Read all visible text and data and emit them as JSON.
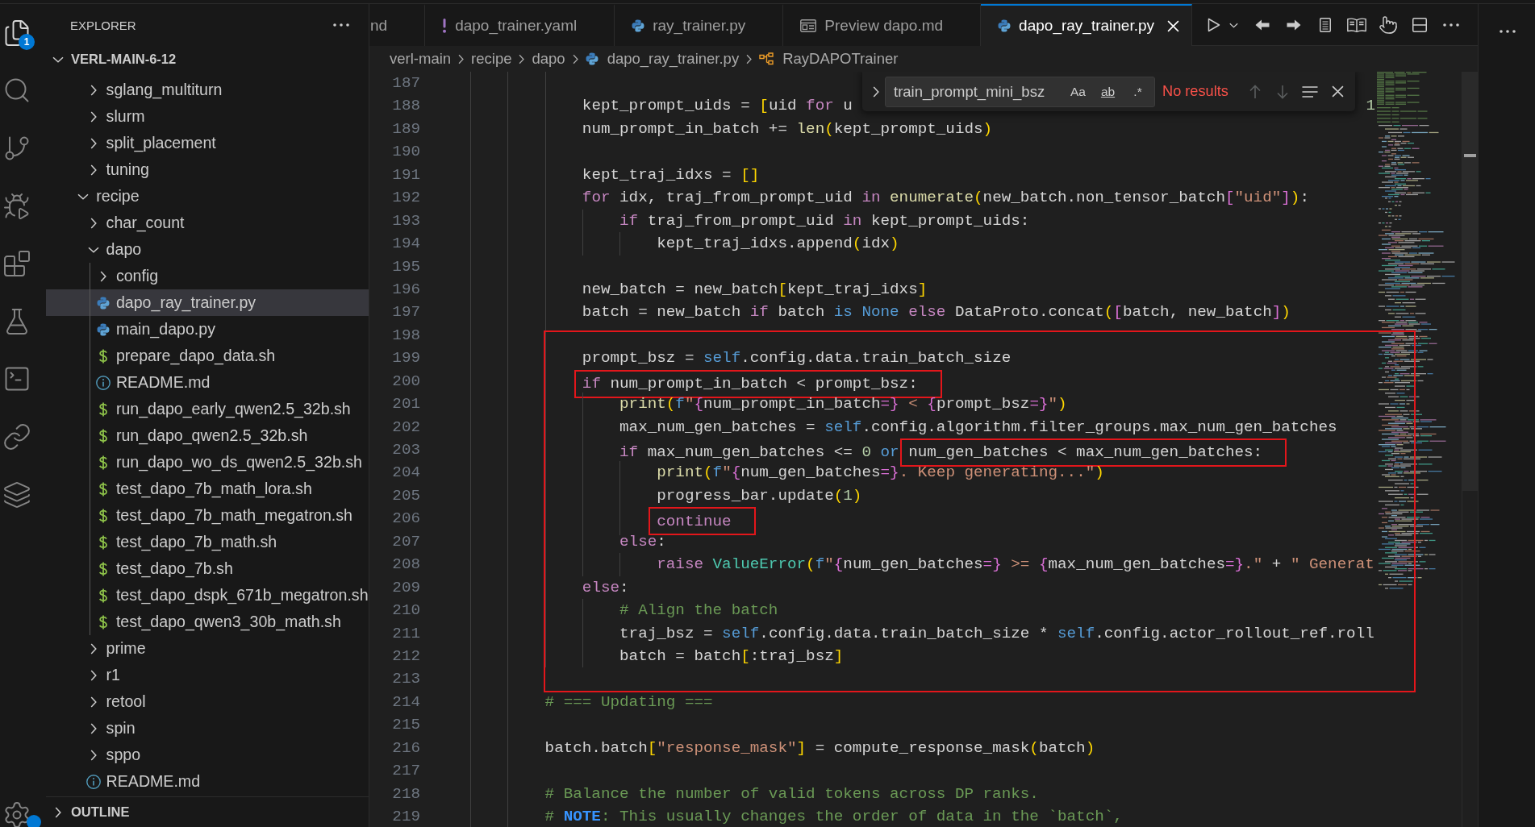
{
  "activity_bar": {
    "items": [
      {
        "kind": "explorer",
        "selected": true,
        "badge": "1"
      },
      {
        "kind": "search",
        "selected": false
      },
      {
        "kind": "source_control",
        "selected": false
      },
      {
        "kind": "run_debug",
        "selected": false
      },
      {
        "kind": "extensions",
        "selected": false
      },
      {
        "kind": "testing",
        "selected": false
      },
      {
        "kind": "terminal",
        "selected": false
      },
      {
        "kind": "link",
        "selected": false
      },
      {
        "kind": "layers",
        "selected": false
      }
    ],
    "manage": {
      "notification": true
    }
  },
  "explorer": {
    "title": "EXPLORER",
    "root": {
      "label": "VERL-MAIN-6-12",
      "expanded": true
    },
    "tree": [
      {
        "children": [
          {
            "label": "sglang_multiturn",
            "kind": "folder",
            "expanded": false,
            "selected": false
          },
          {
            "label": "slurm",
            "kind": "folder",
            "expanded": false,
            "selected": false
          },
          {
            "label": "split_placement",
            "kind": "folder",
            "expanded": false,
            "selected": false
          },
          {
            "label": "tuning",
            "kind": "folder",
            "expanded": false,
            "selected": false
          }
        ]
      },
      {
        "label": "recipe",
        "kind": "folder",
        "expanded": true,
        "selected": false,
        "children": [
          {
            "label": "char_count",
            "kind": "folder",
            "expanded": false,
            "selected": false
          },
          {
            "label": "dapo",
            "kind": "folder",
            "expanded": true,
            "selected": false,
            "children": [
              {
                "label": "config",
                "kind": "folder",
                "expanded": false,
                "selected": false
              },
              {
                "label": "dapo_ray_trainer.py",
                "kind": "python",
                "selected": true
              },
              {
                "label": "main_dapo.py",
                "kind": "python",
                "selected": false
              },
              {
                "label": "prepare_dapo_data.sh",
                "kind": "shell",
                "selected": false
              },
              {
                "label": "README.md",
                "kind": "markdown",
                "selected": false
              },
              {
                "label": "run_dapo_early_qwen2.5_32b.sh",
                "kind": "shell",
                "selected": false
              },
              {
                "label": "run_dapo_qwen2.5_32b.sh",
                "kind": "shell",
                "selected": false
              },
              {
                "label": "run_dapo_wo_ds_qwen2.5_32b.sh",
                "kind": "shell",
                "selected": false
              },
              {
                "label": "test_dapo_7b_math_lora.sh",
                "kind": "shell",
                "selected": false
              },
              {
                "label": "test_dapo_7b_math_megatron.sh",
                "kind": "shell",
                "selected": false
              },
              {
                "label": "test_dapo_7b_math.sh",
                "kind": "shell",
                "selected": false
              },
              {
                "label": "test_dapo_7b.sh",
                "kind": "shell",
                "selected": false
              },
              {
                "label": "test_dapo_dspk_671b_megatron.sh",
                "kind": "shell",
                "selected": false
              },
              {
                "label": "test_dapo_qwen3_30b_math.sh",
                "kind": "shell",
                "selected": false
              }
            ]
          },
          {
            "label": "prime",
            "kind": "folder",
            "expanded": false,
            "selected": false
          },
          {
            "label": "r1",
            "kind": "folder",
            "expanded": false,
            "selected": false
          },
          {
            "label": "retool",
            "kind": "folder",
            "expanded": false,
            "selected": false
          },
          {
            "label": "spin",
            "kind": "folder",
            "expanded": false,
            "selected": false
          },
          {
            "label": "sppo",
            "kind": "folder",
            "expanded": false,
            "selected": false
          },
          {
            "label": "README.md",
            "kind": "markdown",
            "selected": false
          }
        ]
      }
    ],
    "outline": {
      "label": "OUTLINE",
      "expanded": false
    }
  },
  "tabs": [
    {
      "label": "nd",
      "kind": "partial",
      "selected": false
    },
    {
      "label": "dapo_trainer.yaml",
      "kind": "yaml",
      "selected": false
    },
    {
      "label": "ray_trainer.py",
      "kind": "python",
      "selected": false
    },
    {
      "label": "Preview dapo.md",
      "kind": "preview",
      "selected": false
    },
    {
      "label": "dapo_ray_trainer.py",
      "kind": "python",
      "selected": true
    }
  ],
  "breadcrumbs": [
    {
      "label": "verl-main",
      "kind": "folder"
    },
    {
      "label": "recipe",
      "kind": "folder"
    },
    {
      "label": "dapo",
      "kind": "folder"
    },
    {
      "label": "dapo_ray_trainer.py",
      "kind": "python"
    },
    {
      "label": "RayDAPOTrainer",
      "kind": "class"
    }
  ],
  "find_widget": {
    "query": "train_prompt_mini_bsz",
    "options": [
      {
        "label": "Aa",
        "kind": "match_case",
        "on": false
      },
      {
        "label": "ab",
        "kind": "whole_word",
        "on": false
      },
      {
        "label": ".*",
        "kind": "regex",
        "on": false
      }
    ],
    "status": "No results",
    "buttons": [
      {
        "kind": "previous",
        "disabled": true
      },
      {
        "kind": "next",
        "disabled": true
      },
      {
        "kind": "in_selection",
        "disabled": false
      },
      {
        "kind": "close",
        "disabled": false
      }
    ]
  },
  "code": {
    "segments": [
      {
        "marked": false,
        "lines": [
          {
            "number": "187"
          },
          {
            "number": "188",
            "tokens": [
              {
                "text": "                kept_prompt_uids = ",
                "kind": "plain"
              },
              {
                "text": "[",
                "kind": "bracket_1"
              },
              {
                "text": "uid ",
                "kind": "plain"
              },
              {
                "text": "for",
                "kind": "control"
              },
              {
                "text": " u",
                "kind": "plain"
              }
            ],
            "tail": [
              {
                "text": "1",
                "kind": "number"
              }
            ]
          },
          {
            "number": "189",
            "tokens": [
              {
                "text": "                num_prompt_in_batch += ",
                "kind": "plain"
              },
              {
                "text": "len",
                "kind": "call"
              },
              {
                "text": "(",
                "kind": "bracket_1"
              },
              {
                "text": "kept_prompt_uids",
                "kind": "plain"
              },
              {
                "text": ")",
                "kind": "bracket_1"
              }
            ]
          },
          {
            "number": "190"
          },
          {
            "number": "191",
            "tokens": [
              {
                "text": "                kept_traj_idxs = ",
                "kind": "plain"
              },
              {
                "text": "[]",
                "kind": "bracket_1"
              }
            ]
          },
          {
            "number": "192",
            "tokens": [
              {
                "text": "                for",
                "kind": "control"
              },
              {
                "text": " idx, traj_from_prompt_uid ",
                "kind": "plain"
              },
              {
                "text": "in",
                "kind": "control"
              },
              {
                "text": " enumerate",
                "kind": "call"
              },
              {
                "text": "(",
                "kind": "bracket_1"
              },
              {
                "text": "new_batch.non_tensor_batch",
                "kind": "plain"
              },
              {
                "text": "[",
                "kind": "bracket_2"
              },
              {
                "text": "\"uid\"",
                "kind": "string"
              },
              {
                "text": "]",
                "kind": "bracket_2"
              },
              {
                "text": ")",
                "kind": "bracket_1"
              },
              {
                "text": ":",
                "kind": "plain"
              }
            ]
          },
          {
            "number": "193",
            "tokens": [
              {
                "text": "                    if",
                "kind": "control"
              },
              {
                "text": " traj_from_prompt_uid ",
                "kind": "plain"
              },
              {
                "text": "in",
                "kind": "control"
              },
              {
                "text": " kept_prompt_uids:",
                "kind": "plain"
              }
            ]
          },
          {
            "number": "194",
            "tokens": [
              {
                "text": "                        kept_traj_idxs.append",
                "kind": "plain"
              },
              {
                "text": "(",
                "kind": "bracket_1"
              },
              {
                "text": "idx",
                "kind": "plain"
              },
              {
                "text": ")",
                "kind": "bracket_1"
              }
            ]
          },
          {
            "number": "195"
          },
          {
            "number": "196",
            "tokens": [
              {
                "text": "                new_batch = new_batch",
                "kind": "plain"
              },
              {
                "text": "[",
                "kind": "bracket_1"
              },
              {
                "text": "kept_traj_idxs",
                "kind": "plain"
              },
              {
                "text": "]",
                "kind": "bracket_1"
              }
            ]
          },
          {
            "number": "197",
            "tokens": [
              {
                "text": "                batch = new_batch ",
                "kind": "plain"
              },
              {
                "text": "if",
                "kind": "control"
              },
              {
                "text": " batch ",
                "kind": "plain"
              },
              {
                "text": "is None",
                "kind": "builtin"
              },
              {
                "text": " else",
                "kind": "control"
              },
              {
                "text": " DataProto.concat",
                "kind": "plain"
              },
              {
                "text": "(",
                "kind": "bracket_1"
              },
              {
                "text": "[",
                "kind": "bracket_2"
              },
              {
                "text": "batch, new_batch",
                "kind": "plain"
              },
              {
                "text": "]",
                "kind": "bracket_2"
              },
              {
                "text": ")",
                "kind": "bracket_1"
              }
            ]
          }
        ]
      },
      {
        "marked": true,
        "lines": [
          {
            "number": "198"
          },
          {
            "number": "199",
            "tokens": [
              {
                "text": "                prompt_bsz = ",
                "kind": "plain"
              },
              {
                "text": "self",
                "kind": "builtin"
              },
              {
                "text": ".config.data.train_batch_size",
                "kind": "plain"
              }
            ]
          },
          {
            "number": "200",
            "boxed": [
              {
                "text": "                if",
                "kind": "control"
              },
              {
                "text": " num_prompt_in_batch < prompt_bsz:",
                "kind": "plain"
              }
            ]
          },
          {
            "number": "201",
            "tokens": [
              {
                "text": "                    print",
                "kind": "call"
              },
              {
                "text": "(",
                "kind": "bracket_1"
              },
              {
                "text": "f",
                "kind": "builtin"
              },
              {
                "text": "\"",
                "kind": "string"
              },
              {
                "text": "{",
                "kind": "bracket_2"
              },
              {
                "text": "num_prompt_in_batch",
                "kind": "plain"
              },
              {
                "text": "=}",
                "kind": "bracket_2"
              },
              {
                "text": " < ",
                "kind": "string"
              },
              {
                "text": "{",
                "kind": "bracket_2"
              },
              {
                "text": "prompt_bsz",
                "kind": "plain"
              },
              {
                "text": "=}",
                "kind": "bracket_2"
              },
              {
                "text": "\"",
                "kind": "string"
              },
              {
                "text": ")",
                "kind": "bracket_1"
              }
            ]
          },
          {
            "number": "202",
            "tokens": [
              {
                "text": "                    max_num_gen_batches = ",
                "kind": "plain"
              },
              {
                "text": "self",
                "kind": "builtin"
              },
              {
                "text": ".config.algorithm.filter_groups.max_num_gen_batches",
                "kind": "plain"
              }
            ]
          },
          {
            "number": "203",
            "tokens": [
              {
                "text": "                    if",
                "kind": "control"
              },
              {
                "text": " max_num_gen_batches <= ",
                "kind": "plain"
              },
              {
                "text": "0",
                "kind": "number"
              },
              {
                "text": " or ",
                "kind": "builtin"
              }
            ],
            "boxed": [
              {
                "text": "num_gen_batches < max_num_gen_batches:",
                "kind": "plain"
              }
            ]
          },
          {
            "number": "204",
            "tokens": [
              {
                "text": "                        print",
                "kind": "call"
              },
              {
                "text": "(",
                "kind": "bracket_1"
              },
              {
                "text": "f",
                "kind": "builtin"
              },
              {
                "text": "\"",
                "kind": "string"
              },
              {
                "text": "{",
                "kind": "bracket_2"
              },
              {
                "text": "num_gen_batches",
                "kind": "plain"
              },
              {
                "text": "=}",
                "kind": "bracket_2"
              },
              {
                "text": ". Keep generating...\"",
                "kind": "string"
              },
              {
                "text": ")",
                "kind": "bracket_1"
              }
            ]
          },
          {
            "number": "205",
            "tokens": [
              {
                "text": "                        progress_bar.update",
                "kind": "plain"
              },
              {
                "text": "(",
                "kind": "bracket_1"
              },
              {
                "text": "1",
                "kind": "number"
              },
              {
                "text": ")",
                "kind": "bracket_1"
              }
            ]
          },
          {
            "number": "206",
            "boxed": [
              {
                "text": "                        continue",
                "kind": "control"
              }
            ]
          },
          {
            "number": "207",
            "tokens": [
              {
                "text": "                    else",
                "kind": "control"
              },
              {
                "text": ":",
                "kind": "plain"
              }
            ]
          },
          {
            "number": "208",
            "tokens": [
              {
                "text": "                        raise",
                "kind": "control"
              },
              {
                "text": " ValueError",
                "kind": "type"
              },
              {
                "text": "(",
                "kind": "bracket_1"
              },
              {
                "text": "f",
                "kind": "builtin"
              },
              {
                "text": "\"",
                "kind": "string"
              },
              {
                "text": "{",
                "kind": "bracket_2"
              },
              {
                "text": "num_gen_batches",
                "kind": "plain"
              },
              {
                "text": "=}",
                "kind": "bracket_2"
              },
              {
                "text": " >= ",
                "kind": "string"
              },
              {
                "text": "{",
                "kind": "bracket_2"
              },
              {
                "text": "max_num_gen_batches",
                "kind": "plain"
              },
              {
                "text": "=}",
                "kind": "bracket_2"
              },
              {
                "text": ".\"",
                "kind": "string"
              },
              {
                "text": " + ",
                "kind": "plain"
              },
              {
                "text": "\" Generat",
                "kind": "string"
              }
            ]
          },
          {
            "number": "209",
            "tokens": [
              {
                "text": "                else",
                "kind": "control"
              },
              {
                "text": ":",
                "kind": "plain"
              }
            ]
          },
          {
            "number": "210",
            "tokens": [
              {
                "text": "                    # Align the batch",
                "kind": "comment"
              }
            ]
          },
          {
            "number": "211",
            "tokens": [
              {
                "text": "                    traj_bsz = ",
                "kind": "plain"
              },
              {
                "text": "self",
                "kind": "builtin"
              },
              {
                "text": ".config.data.train_batch_size * ",
                "kind": "plain"
              },
              {
                "text": "self",
                "kind": "builtin"
              },
              {
                "text": ".config.actor_rollout_ref.roll",
                "kind": "plain"
              }
            ]
          },
          {
            "number": "212",
            "tokens": [
              {
                "text": "                    batch = batch",
                "kind": "plain"
              },
              {
                "text": "[",
                "kind": "bracket_1"
              },
              {
                "text": ":traj_bsz",
                "kind": "plain"
              },
              {
                "text": "]",
                "kind": "bracket_1"
              }
            ]
          },
          {
            "number": "213"
          }
        ]
      },
      {
        "marked": false,
        "lines": [
          {
            "number": "214",
            "tokens": [
              {
                "text": "            # === Updating ===",
                "kind": "comment"
              }
            ]
          },
          {
            "number": "215"
          },
          {
            "number": "216",
            "tokens": [
              {
                "text": "            batch.batch",
                "kind": "plain"
              },
              {
                "text": "[",
                "kind": "bracket_1"
              },
              {
                "text": "\"response_mask\"",
                "kind": "string"
              },
              {
                "text": "]",
                "kind": "bracket_1"
              },
              {
                "text": " = compute_response_mask",
                "kind": "plain"
              },
              {
                "text": "(",
                "kind": "bracket_1"
              },
              {
                "text": "batch",
                "kind": "plain"
              },
              {
                "text": ")",
                "kind": "bracket_1"
              }
            ]
          },
          {
            "number": "217"
          },
          {
            "number": "218",
            "tokens": [
              {
                "text": "            # Balance the number of valid tokens across DP ranks.",
                "kind": "comment"
              }
            ]
          },
          {
            "number": "219",
            "tokens": [
              {
                "text": "            # ",
                "kind": "comment"
              },
              {
                "text": "NOTE",
                "kind": "tag"
              },
              {
                "text": ": This usually changes the order of data in the `batch`,",
                "kind": "comment"
              }
            ]
          }
        ]
      }
    ]
  }
}
